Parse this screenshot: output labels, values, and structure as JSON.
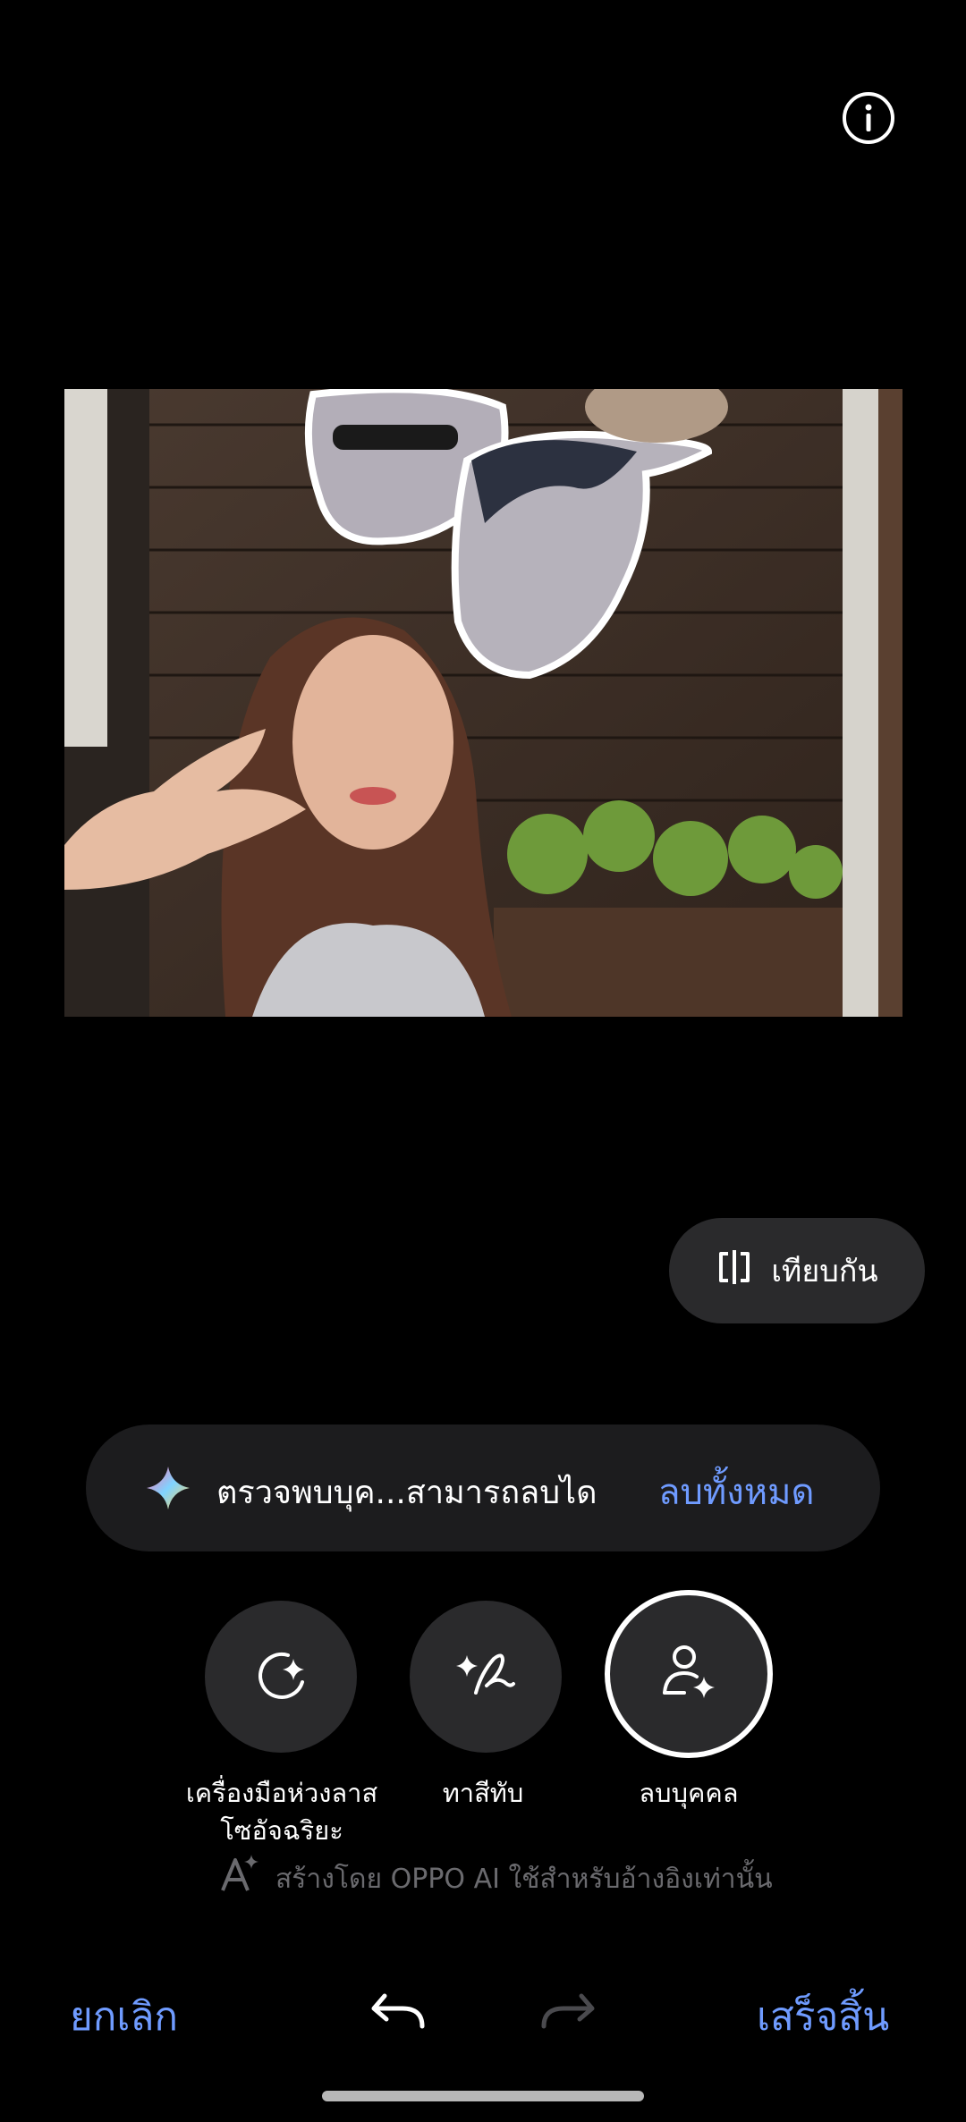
{
  "compare": {
    "label": "เทียบกัน",
    "icon": "compare-split-icon"
  },
  "detection": {
    "message": "ตรวจพบบุค...สามารถลบได",
    "action": "ลบทั้งหมด",
    "icon": "ai-sparkle-icon"
  },
  "tools": [
    {
      "label": "เครื่องมือห่วงลาส\nโซอัจฉริยะ",
      "icon": "smart-lasso-icon"
    },
    {
      "label": "ทาสีทับ",
      "icon": "brush-sparkle-icon"
    },
    {
      "label": "ลบบุคคล",
      "icon": "remove-person-icon",
      "selected": true
    }
  ],
  "ai_notice": "สร้างโดย OPPO AI ใช้สำหรับอ้างอิงเท่านั้น",
  "bottom_bar": {
    "cancel": "ยกเลิก",
    "done": "เสร็จสิ้น"
  },
  "colors": {
    "accent": "#6f9bff",
    "pill_bg": "#2a2a2c",
    "banner_bg": "#1c1c1e"
  }
}
